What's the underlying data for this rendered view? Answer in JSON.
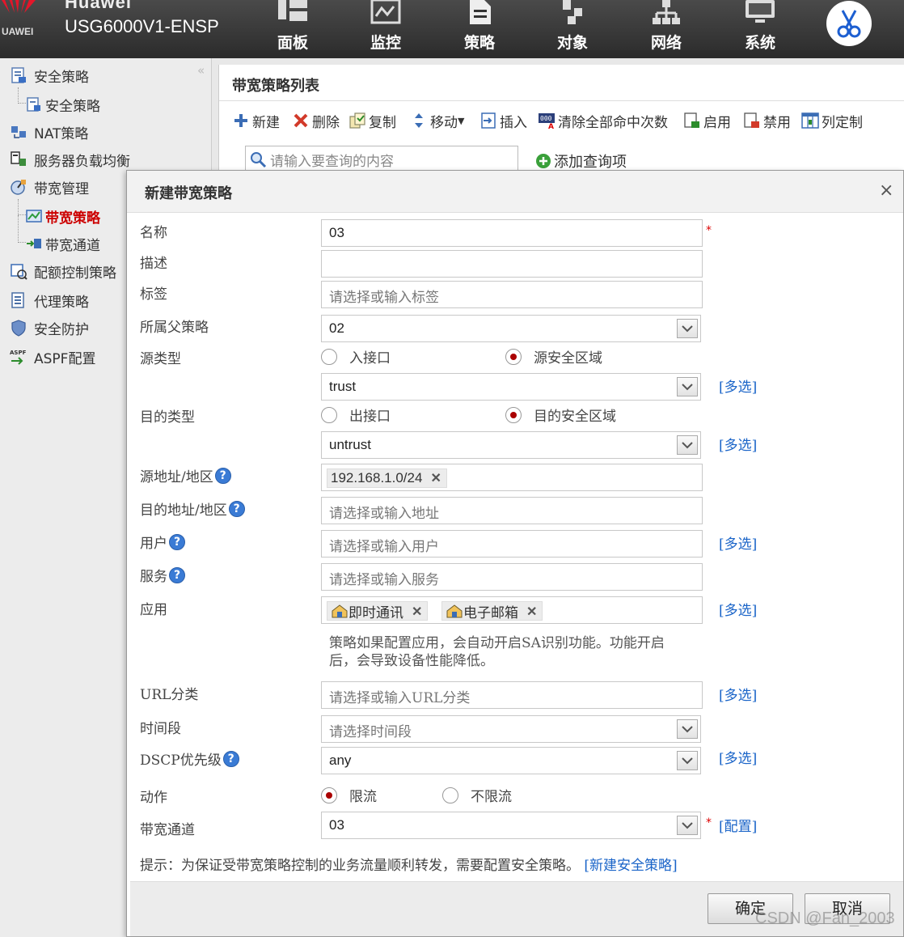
{
  "header": {
    "brand": "Huawei",
    "brand_sub": "UAWEI",
    "device": "USG6000V1-ENSP",
    "nav": [
      {
        "label": "面板",
        "icon": "dashboard-icon"
      },
      {
        "label": "监控",
        "icon": "monitor-icon"
      },
      {
        "label": "策略",
        "icon": "policy-icon"
      },
      {
        "label": "对象",
        "icon": "object-icon"
      },
      {
        "label": "网络",
        "icon": "network-icon"
      },
      {
        "label": "系统",
        "icon": "system-icon"
      }
    ],
    "active_nav": "策略"
  },
  "sidebar": {
    "collapse": "«",
    "items": [
      {
        "label": "安全策略",
        "icon": "security-policy-icon"
      },
      {
        "label": "安全策略",
        "icon": "security-policy-sub-icon"
      },
      {
        "label": "NAT策略",
        "icon": "nat-policy-icon"
      },
      {
        "label": "服务器负载均衡",
        "icon": "load-balance-icon"
      },
      {
        "label": "带宽管理",
        "icon": "bandwidth-icon"
      },
      {
        "label": "带宽策略",
        "icon": "bandwidth-policy-icon"
      },
      {
        "label": "带宽通道",
        "icon": "bandwidth-channel-icon"
      },
      {
        "label": "配额控制策略",
        "icon": "quota-icon"
      },
      {
        "label": "代理策略",
        "icon": "proxy-icon"
      },
      {
        "label": "安全防护",
        "icon": "shield-icon"
      },
      {
        "label": "ASPF配置",
        "icon": "aspf-icon"
      }
    ]
  },
  "list_panel": {
    "title": "带宽策略列表",
    "toolbar": [
      "新建",
      "删除",
      "复制",
      "移动",
      "插入",
      "清除全部命中次数",
      "启用",
      "禁用",
      "列定制"
    ],
    "search_placeholder": "请输入要查询的内容",
    "add_query": "添加查询项"
  },
  "dialog": {
    "title": "新建带宽策略",
    "close": "×",
    "fields": {
      "name": {
        "label": "名称",
        "value": "03"
      },
      "desc": {
        "label": "描述",
        "value": ""
      },
      "tag": {
        "label": "标签",
        "placeholder": "请选择或输入标签"
      },
      "parent": {
        "label": "所属父策略",
        "value": "02"
      },
      "src_type": {
        "label": "源类型",
        "opt1": "入接口",
        "opt2": "源安全区域",
        "selected": "源安全区域",
        "value": "trust"
      },
      "dst_type": {
        "label": "目的类型",
        "opt1": "出接口",
        "opt2": "目的安全区域",
        "selected": "目的安全区域",
        "value": "untrust"
      },
      "src_addr": {
        "label": "源地址/地区",
        "tag": "192.168.1.0/24"
      },
      "dst_addr": {
        "label": "目的地址/地区",
        "placeholder": "请选择或输入地址"
      },
      "user": {
        "label": "用户",
        "placeholder": "请选择或输入用户"
      },
      "service": {
        "label": "服务",
        "placeholder": "请选择或输入服务"
      },
      "app": {
        "label": "应用",
        "tags": [
          "即时通讯",
          "电子邮箱"
        ],
        "note": "策略如果配置应用，会自动开启SA识别功能。功能开启后，会导致设备性能降低。"
      },
      "url": {
        "label": "URL分类",
        "placeholder": "请选择或输入URL分类"
      },
      "time": {
        "label": "时间段",
        "placeholder": "请选择时间段"
      },
      "dscp": {
        "label": "DSCP优先级",
        "value": "any"
      },
      "action": {
        "label": "动作",
        "opt1": "限流",
        "opt2": "不限流",
        "selected": "限流"
      },
      "channel": {
        "label": "带宽通道",
        "value": "03"
      }
    },
    "links": {
      "multi": "[多选]",
      "config": "[配置]"
    },
    "required_mark": "*",
    "help": "?",
    "tip_text": "提示：为保证受带宽策略控制的业务流量顺利转发，需要配置安全策略。",
    "tip_link": "[新建安全策略]",
    "ok": "确定",
    "cancel": "取消"
  },
  "watermark": "CSDN @Fan_2003",
  "colors": {
    "topbar": "#333333",
    "active_red": "#cc0000",
    "link_blue": "#1a64c8",
    "radio_dot": "#aa0000"
  }
}
